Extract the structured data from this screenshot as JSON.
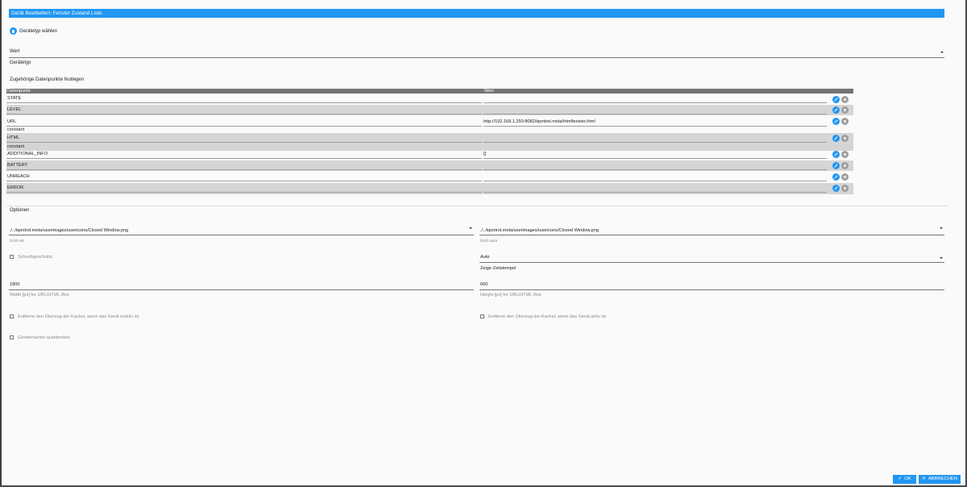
{
  "dialog": {
    "title": "Gerät Bearbeiten: Fenster Zustand Liste",
    "device_type_button": "Gerätetyp wählen",
    "device_type_select": {
      "value": "Wert",
      "label": "Gerätetyp"
    },
    "section_datapoints": "Zugehörige Datenpunkte festlegen",
    "table": {
      "headers": [
        "Datenpunkt",
        "Wert"
      ],
      "rows": [
        {
          "name": "STATE",
          "value": "",
          "constant": false
        },
        {
          "name": "LEVEL",
          "value": "",
          "constant": false
        },
        {
          "name": "URL",
          "value": "http://192.168.1.250:8082/iqontrol.meta/htmlfenster.html",
          "constant": false
        },
        {
          "name": "HTML",
          "value": "",
          "constant": true
        },
        {
          "name": "ADDITIONAL_INFO",
          "value": "[]",
          "constant": false
        },
        {
          "name": "BATTERY",
          "value": "",
          "constant": false
        },
        {
          "name": "UNREACH",
          "value": "",
          "constant": false
        },
        {
          "name": "ERROR",
          "value": "",
          "constant": false
        }
      ],
      "constant_label": "constant"
    },
    "section_options": "Optionen",
    "options": {
      "icon_on": {
        "value": "./../iqontrol.meta/userimages/usericons/Closed Window.png",
        "label": "Icon an"
      },
      "icon_off": {
        "value": "./../iqontrol.meta/userimages/usericons/Closed Window.png",
        "label": "Icon aus"
      },
      "readonly": {
        "label": "Schreibgeschützt",
        "checked": false
      },
      "timestamp": {
        "value": "Auto",
        "label": "Zeige Zeitstempel"
      },
      "width": {
        "value": "1800",
        "label": "Width [px] for URL/HTML-Box"
      },
      "height": {
        "value": "600",
        "label": "Height [px] for URL/HTML-Box"
      },
      "remove_overlay_inactive": {
        "label": "Entferne den Überzug der Kachel, wenn das Gerät inaktiv ist",
        "checked": false
      },
      "remove_overlay_active": {
        "label": "Entferne den Überzug der Kachel, wenn das Gerät aktiv ist",
        "checked": false
      },
      "hide_name": {
        "label": "Gerätenamen ausblenden",
        "checked": false
      }
    },
    "buttons": {
      "ok": "OK",
      "cancel": "ABBRECHEN"
    },
    "colors": {
      "accent": "#2196f3",
      "header": "#757575",
      "row_alt": "#d5d5d5"
    }
  }
}
